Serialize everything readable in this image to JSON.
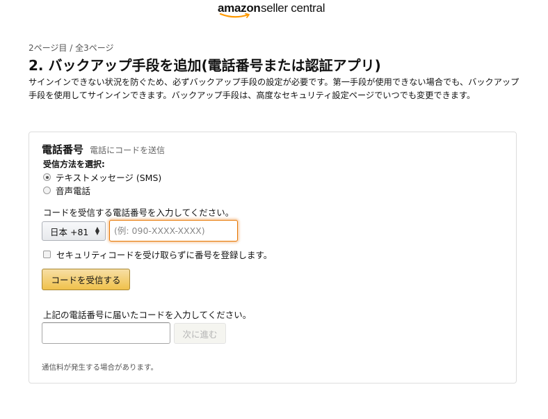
{
  "header": {
    "logo_brand": "amazon",
    "logo_product": "seller central"
  },
  "step_indicator": "2ページ目 / 全3ページ",
  "page_title": "2. バックアップ手段を追加(電話番号または認証アプリ)",
  "description": "サインインできない状況を防ぐため、必ずバックアップ手段の設定が必要です。第一手段が使用できない場合でも、バックアップ手段を使用してサインインできます。バックアップ手段は、高度なセキュリティ設定ページでいつでも変更できます。",
  "phone_section": {
    "title": "電話番号",
    "subtitle": "電話にコードを送信",
    "method_label": "受信方法を選択:",
    "methods": [
      {
        "label": "テキストメッセージ (SMS)",
        "selected": true
      },
      {
        "label": "音声電話",
        "selected": false
      }
    ],
    "phone_label": "コードを受信する電話番号を入力してください。",
    "country_select": "日本 +81",
    "phone_placeholder": "(例: 090-XXXX-XXXX)",
    "phone_value": "",
    "skip_checkbox_label": "セキュリティコードを受け取らずに番号を登録します。",
    "skip_checked": false,
    "send_button": "コードを受信する",
    "code_label": "上記の電話番号に届いたコードを入力してください。",
    "code_value": "",
    "next_button": "次に進む",
    "note": "通信料が発生する場合があります。"
  },
  "colors": {
    "primary_button_top": "#f7dfa5",
    "primary_button_bottom": "#f0c14b",
    "focus_border": "#e77600",
    "brand_orange": "#ff9900"
  }
}
